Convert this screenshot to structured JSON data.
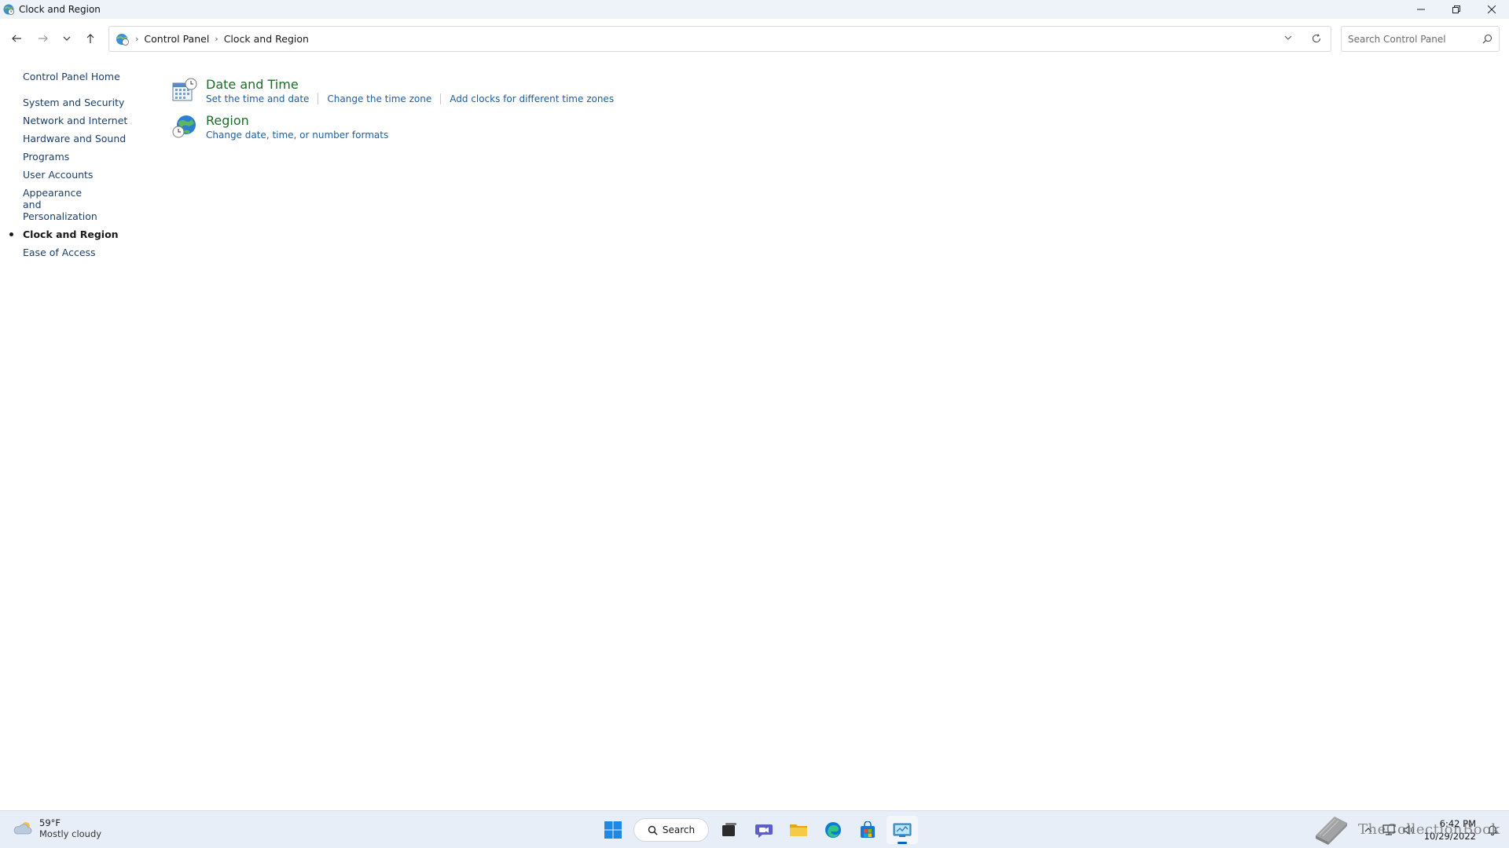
{
  "window": {
    "title": "Clock and Region",
    "controls": {
      "minimize": "—",
      "maximize": "⧉",
      "close": "✕"
    }
  },
  "address": {
    "breadcrumbs": [
      "Control Panel",
      "Clock and Region"
    ],
    "search_placeholder": "Search Control Panel"
  },
  "sidebar": {
    "home": "Control Panel Home",
    "items": [
      {
        "label": "System and Security"
      },
      {
        "label": "Network and Internet"
      },
      {
        "label": "Hardware and Sound"
      },
      {
        "label": "Programs"
      },
      {
        "label": "User Accounts"
      },
      {
        "label": "Appearance and Personalization"
      },
      {
        "label": "Clock and Region",
        "active": true
      },
      {
        "label": "Ease of Access"
      }
    ]
  },
  "categories": [
    {
      "title": "Date and Time",
      "icon": "calendar-clock-icon",
      "links": [
        "Set the time and date",
        "Change the time zone",
        "Add clocks for different time zones"
      ]
    },
    {
      "title": "Region",
      "icon": "globe-clock-icon",
      "links": [
        "Change date, time, or number formats"
      ]
    }
  ],
  "taskbar": {
    "weather": {
      "temp": "59°F",
      "condition": "Mostly cloudy"
    },
    "search_label": "Search",
    "apps": [
      "start-icon",
      "search",
      "task-view-icon",
      "teams-chat-icon",
      "file-explorer-icon",
      "edge-icon",
      "store-icon",
      "control-panel-icon"
    ],
    "clock": {
      "time": "6:42 PM",
      "date": "10/29/2022"
    },
    "watermark": "TheCollectionBook"
  },
  "colors": {
    "category_title": "#1e6b2c",
    "link": "#1a5fa8",
    "sidebar_link": "#1c3f6b",
    "taskbar_bg": "#e8eef7"
  }
}
